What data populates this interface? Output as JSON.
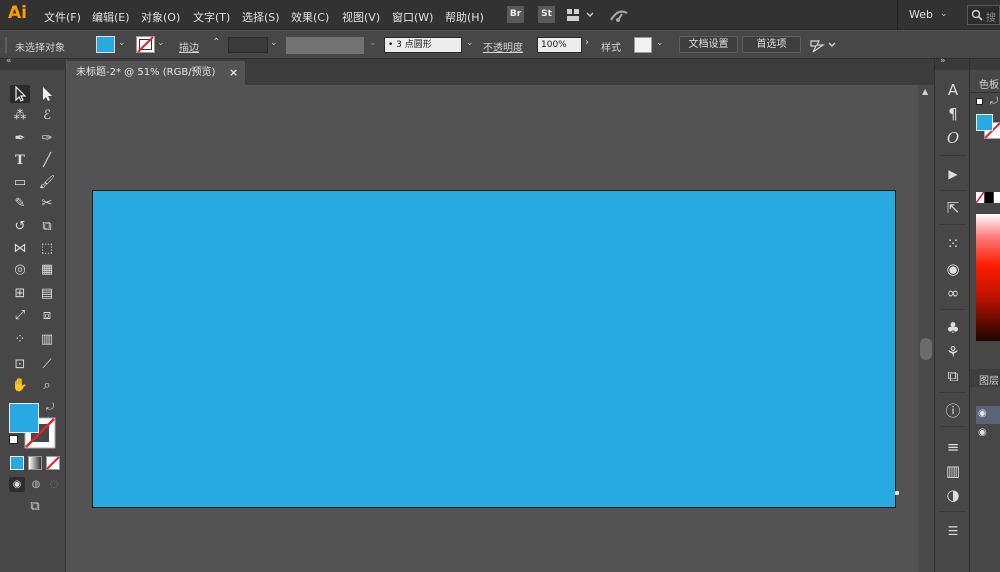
{
  "app": {
    "logo": "Ai",
    "menus": [
      "文件(F)",
      "编辑(E)",
      "对象(O)",
      "文字(T)",
      "选择(S)",
      "效果(C)",
      "视图(V)",
      "窗口(W)",
      "帮助(H)"
    ],
    "bridge_button": "Br",
    "stock_button": "St",
    "workspace": "Web",
    "search_placeholder": "搜"
  },
  "control_bar": {
    "selection_status": "未选择对象",
    "stroke_label": "描边",
    "brush_value": "3 点圆形",
    "opacity_label": "不透明度",
    "opacity_value": "100%",
    "style_label": "样式",
    "doc_setup_button": "文档设置",
    "preferences_button": "首选项"
  },
  "document": {
    "tab_title": "未标题-2* @ 51% (RGB/预览)",
    "close_glyph": "×"
  },
  "colors": {
    "fill": "#29a9e1",
    "artboard": "#29a9e1",
    "accent_logo": "#ff9a00"
  },
  "panels": {
    "color_tab": "色板",
    "layers_tab": "图层"
  }
}
